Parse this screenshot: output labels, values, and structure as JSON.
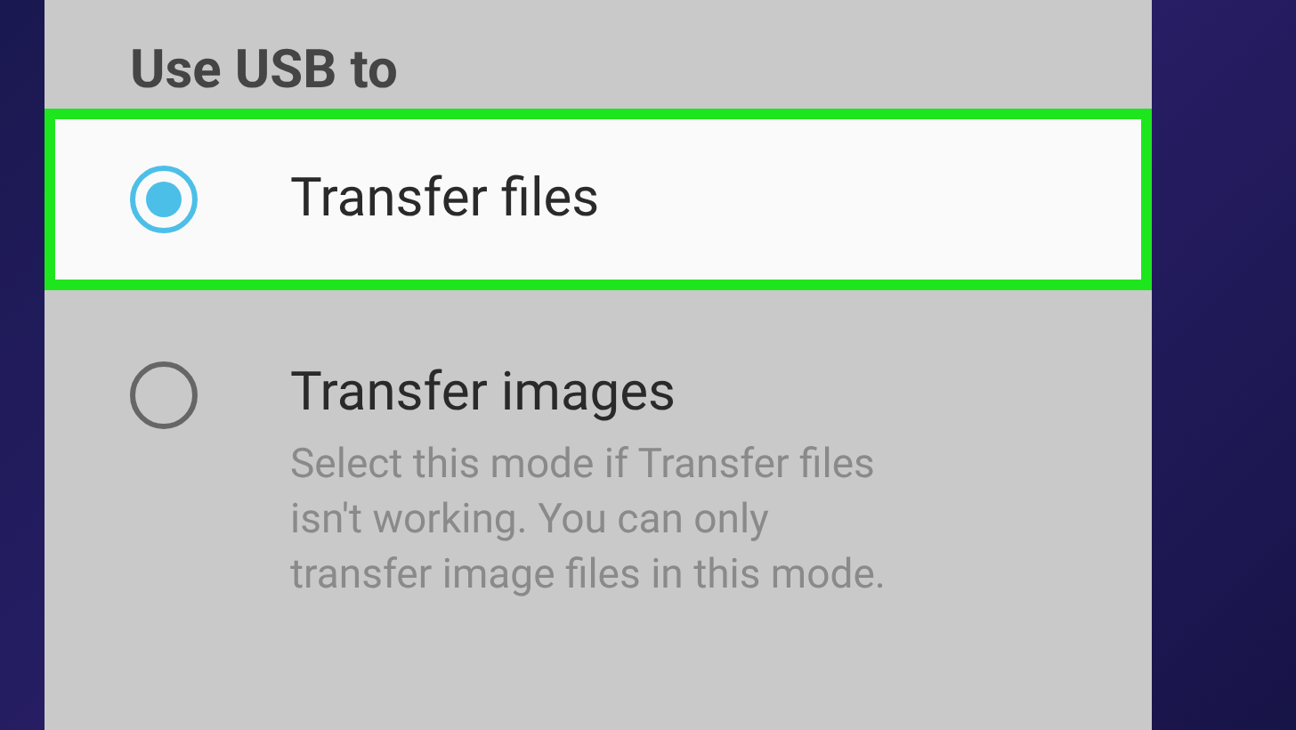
{
  "title": "Use USB to",
  "options": [
    {
      "label": "Transfer files",
      "selected": true
    },
    {
      "label": "Transfer images",
      "selected": false,
      "description": "Select this mode if Transfer files isn't working. You can only transfer image files in this mode."
    }
  ]
}
